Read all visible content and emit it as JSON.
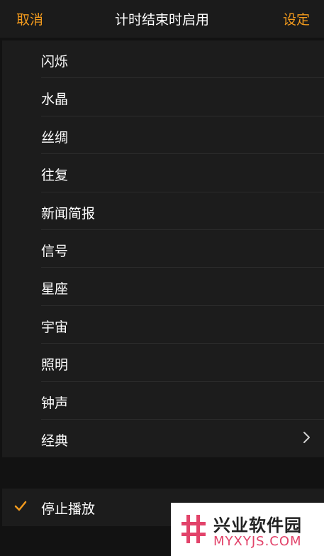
{
  "header": {
    "cancel_label": "取消",
    "title": "计时结束时启用",
    "set_label": "设定"
  },
  "items": [
    {
      "label": "闪烁"
    },
    {
      "label": "水晶"
    },
    {
      "label": "丝绸"
    },
    {
      "label": "往复"
    },
    {
      "label": "新闻简报"
    },
    {
      "label": "信号"
    },
    {
      "label": "星座"
    },
    {
      "label": "宇宙"
    },
    {
      "label": "照明"
    },
    {
      "label": "钟声"
    },
    {
      "label": "经典",
      "icon": "chevron-right-icon"
    }
  ],
  "stop": {
    "label": "停止播放",
    "selected": true,
    "icon": "checkmark-icon"
  },
  "watermark": {
    "name": "兴业软件园",
    "url": "MYXYJS.COM"
  },
  "colors": {
    "accent": "#f29a1d",
    "background": "#121212",
    "row_background": "#1c1c1c",
    "watermark_pink": "#e2436a"
  }
}
